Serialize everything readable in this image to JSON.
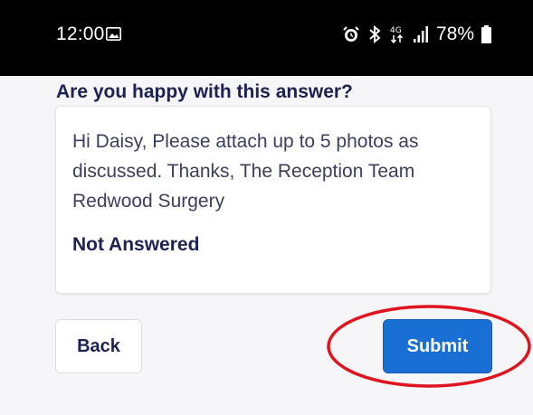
{
  "status_bar": {
    "time": "12:00",
    "battery": "78%",
    "network": "4G",
    "icons": [
      "image-icon",
      "alarm-icon",
      "bluetooth-icon",
      "network-4g-icon",
      "signal-icon",
      "battery-icon"
    ]
  },
  "question": "Are you happy with this answer?",
  "answer": {
    "text": "Hi Daisy, Please attach up to 5 photos as discussed. Thanks, The Reception Team Redwood Surgery",
    "status": "Not Answered"
  },
  "buttons": {
    "back_label": "Back",
    "submit_label": "Submit"
  },
  "colors": {
    "status_bar": "#000000",
    "question_text": "#1d2252",
    "primary_button": "#1a6fd4",
    "highlight": "#e0141e"
  }
}
